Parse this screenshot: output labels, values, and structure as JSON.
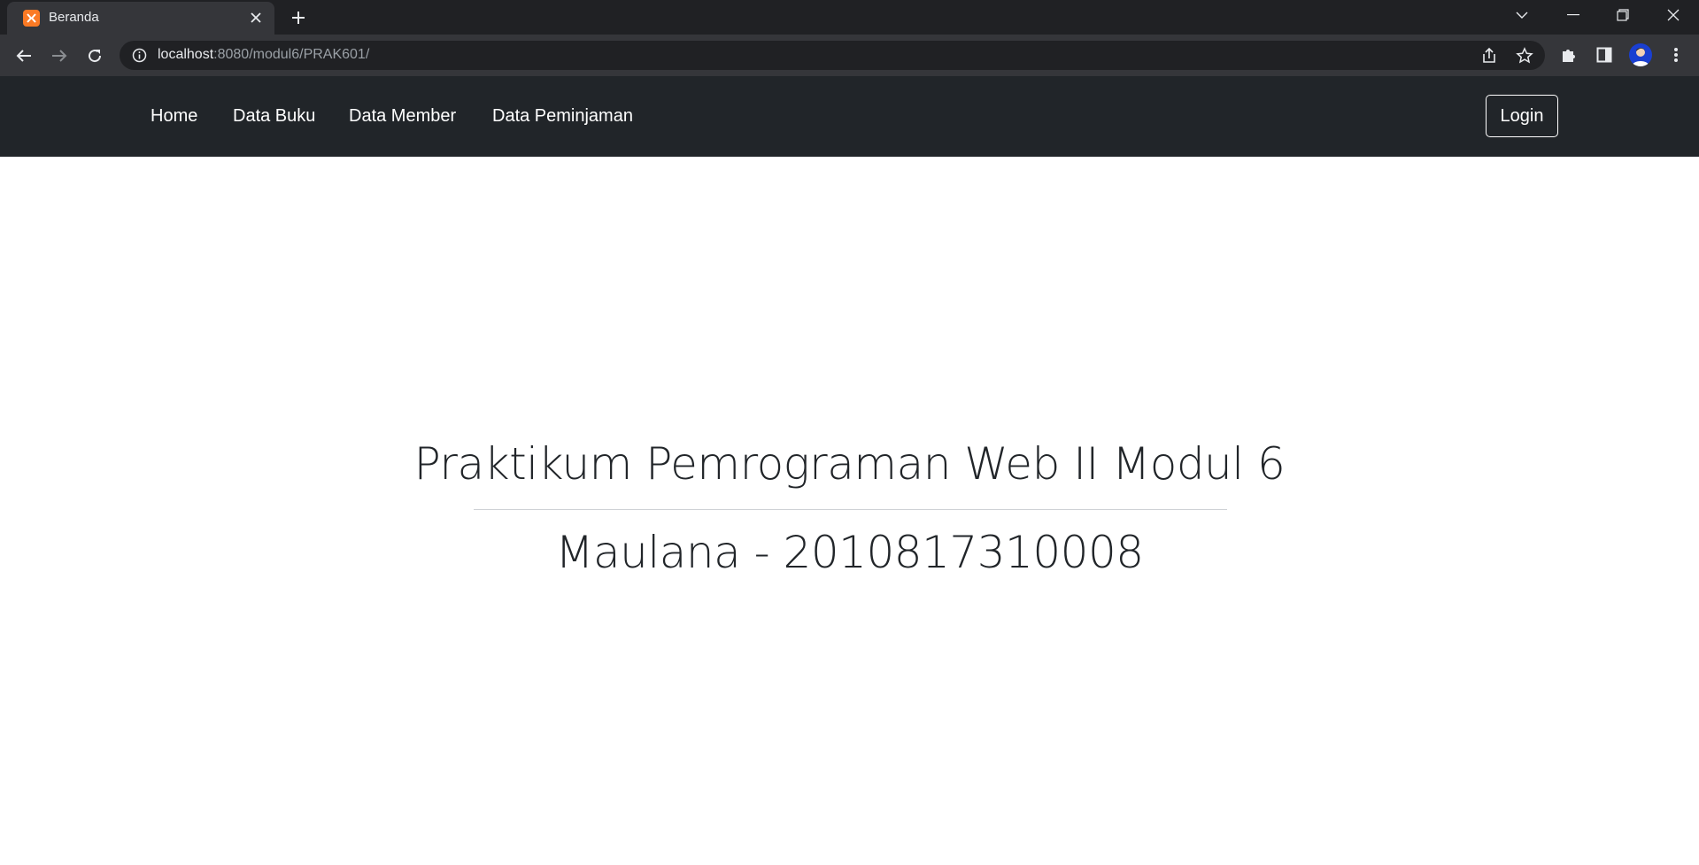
{
  "browser": {
    "tab_title": "Beranda",
    "url_host": "localhost",
    "url_path": ":8080/modul6/PRAK601/"
  },
  "navbar": {
    "links": [
      "Home",
      "Data Buku",
      "Data Member",
      "Data Peminjaman"
    ],
    "login_label": "Login"
  },
  "hero": {
    "title": "Praktikum Pemrograman Web II Modul 6",
    "subtitle": "Maulana - 2010817310008"
  },
  "colors": {
    "navbar_bg": "#212529",
    "chrome_bg": "#202124",
    "toolbar_bg": "#35363a",
    "favicon": "#fb7a24"
  },
  "icons": {
    "back": "arrow-left-icon",
    "forward": "arrow-right-icon",
    "reload": "reload-icon",
    "info": "info-icon",
    "share": "share-icon",
    "star": "star-icon",
    "extensions": "puzzle-icon",
    "sidepanel": "side-panel-icon",
    "menu": "kebab-menu-icon"
  }
}
